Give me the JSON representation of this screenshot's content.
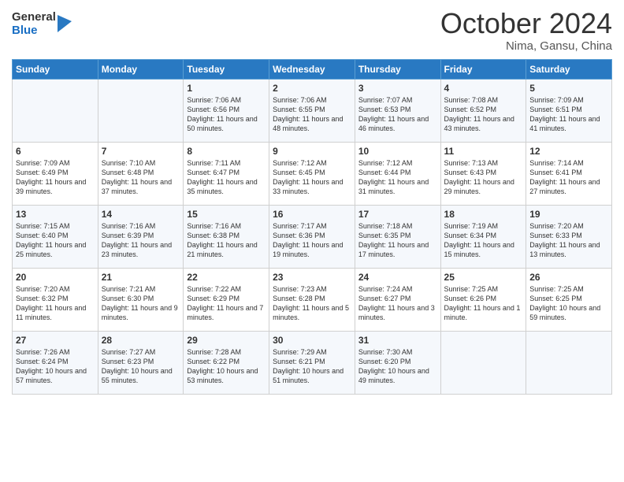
{
  "header": {
    "logo_general": "General",
    "logo_blue": "Blue",
    "month": "October 2024",
    "location": "Nima, Gansu, China"
  },
  "weekdays": [
    "Sunday",
    "Monday",
    "Tuesday",
    "Wednesday",
    "Thursday",
    "Friday",
    "Saturday"
  ],
  "weeks": [
    [
      {
        "day": "",
        "info": ""
      },
      {
        "day": "",
        "info": ""
      },
      {
        "day": "1",
        "info": "Sunrise: 7:06 AM\nSunset: 6:56 PM\nDaylight: 11 hours and 50 minutes."
      },
      {
        "day": "2",
        "info": "Sunrise: 7:06 AM\nSunset: 6:55 PM\nDaylight: 11 hours and 48 minutes."
      },
      {
        "day": "3",
        "info": "Sunrise: 7:07 AM\nSunset: 6:53 PM\nDaylight: 11 hours and 46 minutes."
      },
      {
        "day": "4",
        "info": "Sunrise: 7:08 AM\nSunset: 6:52 PM\nDaylight: 11 hours and 43 minutes."
      },
      {
        "day": "5",
        "info": "Sunrise: 7:09 AM\nSunset: 6:51 PM\nDaylight: 11 hours and 41 minutes."
      }
    ],
    [
      {
        "day": "6",
        "info": "Sunrise: 7:09 AM\nSunset: 6:49 PM\nDaylight: 11 hours and 39 minutes."
      },
      {
        "day": "7",
        "info": "Sunrise: 7:10 AM\nSunset: 6:48 PM\nDaylight: 11 hours and 37 minutes."
      },
      {
        "day": "8",
        "info": "Sunrise: 7:11 AM\nSunset: 6:47 PM\nDaylight: 11 hours and 35 minutes."
      },
      {
        "day": "9",
        "info": "Sunrise: 7:12 AM\nSunset: 6:45 PM\nDaylight: 11 hours and 33 minutes."
      },
      {
        "day": "10",
        "info": "Sunrise: 7:12 AM\nSunset: 6:44 PM\nDaylight: 11 hours and 31 minutes."
      },
      {
        "day": "11",
        "info": "Sunrise: 7:13 AM\nSunset: 6:43 PM\nDaylight: 11 hours and 29 minutes."
      },
      {
        "day": "12",
        "info": "Sunrise: 7:14 AM\nSunset: 6:41 PM\nDaylight: 11 hours and 27 minutes."
      }
    ],
    [
      {
        "day": "13",
        "info": "Sunrise: 7:15 AM\nSunset: 6:40 PM\nDaylight: 11 hours and 25 minutes."
      },
      {
        "day": "14",
        "info": "Sunrise: 7:16 AM\nSunset: 6:39 PM\nDaylight: 11 hours and 23 minutes."
      },
      {
        "day": "15",
        "info": "Sunrise: 7:16 AM\nSunset: 6:38 PM\nDaylight: 11 hours and 21 minutes."
      },
      {
        "day": "16",
        "info": "Sunrise: 7:17 AM\nSunset: 6:36 PM\nDaylight: 11 hours and 19 minutes."
      },
      {
        "day": "17",
        "info": "Sunrise: 7:18 AM\nSunset: 6:35 PM\nDaylight: 11 hours and 17 minutes."
      },
      {
        "day": "18",
        "info": "Sunrise: 7:19 AM\nSunset: 6:34 PM\nDaylight: 11 hours and 15 minutes."
      },
      {
        "day": "19",
        "info": "Sunrise: 7:20 AM\nSunset: 6:33 PM\nDaylight: 11 hours and 13 minutes."
      }
    ],
    [
      {
        "day": "20",
        "info": "Sunrise: 7:20 AM\nSunset: 6:32 PM\nDaylight: 11 hours and 11 minutes."
      },
      {
        "day": "21",
        "info": "Sunrise: 7:21 AM\nSunset: 6:30 PM\nDaylight: 11 hours and 9 minutes."
      },
      {
        "day": "22",
        "info": "Sunrise: 7:22 AM\nSunset: 6:29 PM\nDaylight: 11 hours and 7 minutes."
      },
      {
        "day": "23",
        "info": "Sunrise: 7:23 AM\nSunset: 6:28 PM\nDaylight: 11 hours and 5 minutes."
      },
      {
        "day": "24",
        "info": "Sunrise: 7:24 AM\nSunset: 6:27 PM\nDaylight: 11 hours and 3 minutes."
      },
      {
        "day": "25",
        "info": "Sunrise: 7:25 AM\nSunset: 6:26 PM\nDaylight: 11 hours and 1 minute."
      },
      {
        "day": "26",
        "info": "Sunrise: 7:25 AM\nSunset: 6:25 PM\nDaylight: 10 hours and 59 minutes."
      }
    ],
    [
      {
        "day": "27",
        "info": "Sunrise: 7:26 AM\nSunset: 6:24 PM\nDaylight: 10 hours and 57 minutes."
      },
      {
        "day": "28",
        "info": "Sunrise: 7:27 AM\nSunset: 6:23 PM\nDaylight: 10 hours and 55 minutes."
      },
      {
        "day": "29",
        "info": "Sunrise: 7:28 AM\nSunset: 6:22 PM\nDaylight: 10 hours and 53 minutes."
      },
      {
        "day": "30",
        "info": "Sunrise: 7:29 AM\nSunset: 6:21 PM\nDaylight: 10 hours and 51 minutes."
      },
      {
        "day": "31",
        "info": "Sunrise: 7:30 AM\nSunset: 6:20 PM\nDaylight: 10 hours and 49 minutes."
      },
      {
        "day": "",
        "info": ""
      },
      {
        "day": "",
        "info": ""
      }
    ]
  ]
}
